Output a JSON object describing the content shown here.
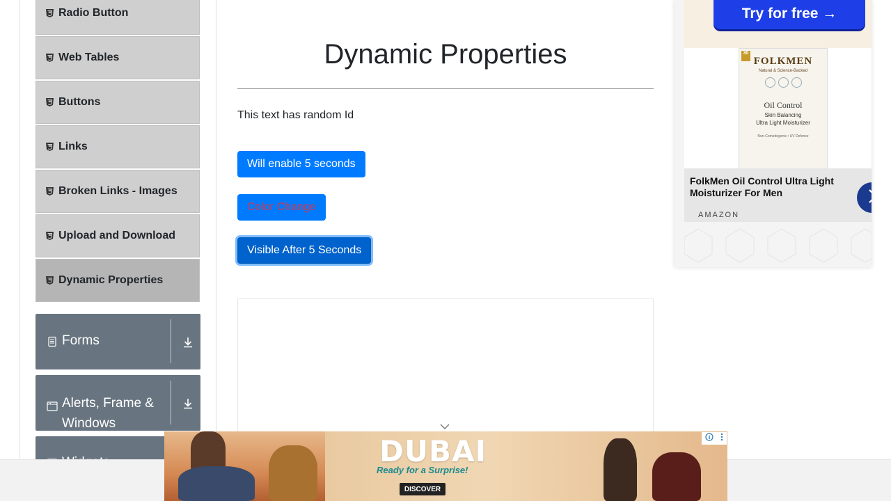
{
  "sidebar": {
    "items": [
      {
        "label": "Radio Button"
      },
      {
        "label": "Web Tables"
      },
      {
        "label": "Buttons"
      },
      {
        "label": "Links"
      },
      {
        "label": "Broken Links - Images"
      },
      {
        "label": "Upload and Download"
      },
      {
        "label": "Dynamic Properties",
        "active": true
      }
    ],
    "groups": [
      {
        "label": "Forms"
      },
      {
        "label": "Alerts, Frame & Windows"
      },
      {
        "label": "Widgets"
      }
    ]
  },
  "main": {
    "title": "Dynamic Properties",
    "random_text": "This text has random Id",
    "buttons": {
      "enable_after": "Will enable 5 seconds",
      "color_change": "Color Change",
      "visible_after": "Visible After 5 Seconds"
    }
  },
  "right_ad": {
    "cta": "Try for free →",
    "brand": "FOLKMEN",
    "brand_tag": "Natural & Science-Backed",
    "product_name": "Oil Control",
    "product_sub": "Skin Balancing",
    "product_sub_line2": "Ultra Light Moisturizer",
    "product_note": "Non-Comedogenic • UV Defense",
    "badge_number": "30",
    "caption": "FolkMen Oil Control Ultra Light Moisturizer For Men",
    "seller": "AMAZON"
  },
  "bottom_ad": {
    "headline": "DUBAI",
    "tagline": "Ready for a Surprise!",
    "cta": "DISCOVER"
  },
  "colors": {
    "primary": "#007bff",
    "sidebar_item": "#cfcfcf",
    "group_bg": "#687580",
    "red_text": "#dc3545"
  }
}
